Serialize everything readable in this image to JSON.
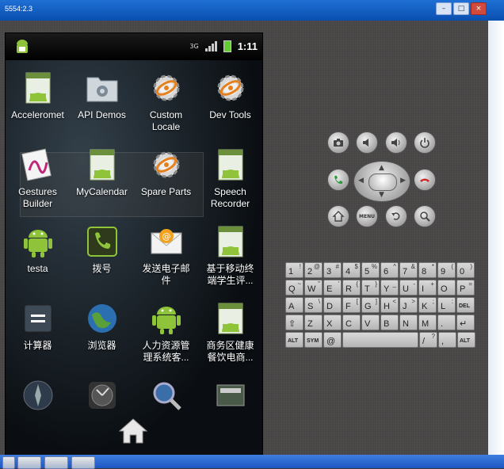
{
  "window": {
    "title": "5554:2.3",
    "minimize_label": "–",
    "maximize_label": "□",
    "close_label": "×"
  },
  "statusbar": {
    "network": "3G",
    "time": "1:11"
  },
  "apps": [
    {
      "label": "Acceleromet",
      "icon": "android-app-icon"
    },
    {
      "label": "API Demos",
      "icon": "folder-gear-icon"
    },
    {
      "label": "Custom\nLocale",
      "icon": "gear-icon"
    },
    {
      "label": "Dev Tools",
      "icon": "gear-icon"
    },
    {
      "label": "Gestures\nBuilder",
      "icon": "gesture-icon"
    },
    {
      "label": "MyCalendar",
      "icon": "android-app-icon"
    },
    {
      "label": "Spare Parts",
      "icon": "gear-icon"
    },
    {
      "label": "Speech\nRecorder",
      "icon": "android-app-icon"
    },
    {
      "label": "testa",
      "icon": "android-robot-icon"
    },
    {
      "label": "拨号",
      "icon": "phone-icon"
    },
    {
      "label": "发送电子邮\n件",
      "icon": "email-icon"
    },
    {
      "label": "基于移动终\n端学生评...",
      "icon": "android-app-icon"
    },
    {
      "label": "计算器",
      "icon": "calculator-icon"
    },
    {
      "label": "浏览器",
      "icon": "globe-icon"
    },
    {
      "label": "人力资源管\n理系统客...",
      "icon": "android-robot-icon"
    },
    {
      "label": "商务区健康\n餐饮电商...",
      "icon": "android-app-icon"
    },
    {
      "label": "",
      "icon": "compass-icon"
    },
    {
      "label": "",
      "icon": "clock-icon"
    },
    {
      "label": "",
      "icon": "search-icon"
    },
    {
      "label": "",
      "icon": "gallery-icon"
    }
  ],
  "controls": {
    "camera": "camera",
    "volume_down": "volume-down",
    "volume_up": "volume-up",
    "power": "power",
    "call": "call",
    "end_call": "end-call",
    "home": "home",
    "menu": "MENU",
    "back": "back",
    "search": "search"
  },
  "keyboard": {
    "rows": [
      [
        {
          "m": "1",
          "s": "!"
        },
        {
          "m": "2",
          "s": "@"
        },
        {
          "m": "3",
          "s": "#"
        },
        {
          "m": "4",
          "s": "$"
        },
        {
          "m": "5",
          "s": "%"
        },
        {
          "m": "6",
          "s": "^"
        },
        {
          "m": "7",
          "s": "&"
        },
        {
          "m": "8",
          "s": "*"
        },
        {
          "m": "9",
          "s": "("
        },
        {
          "m": "0",
          "s": ")"
        }
      ],
      [
        {
          "m": "Q",
          "s": "~"
        },
        {
          "m": "W",
          "s": "\""
        },
        {
          "m": "E",
          "s": "'"
        },
        {
          "m": "R",
          "s": "{"
        },
        {
          "m": "T",
          "s": "}"
        },
        {
          "m": "Y",
          "s": "_"
        },
        {
          "m": "U",
          "s": "-"
        },
        {
          "m": "I",
          "s": "+"
        },
        {
          "m": "O",
          "s": ""
        },
        {
          "m": "P",
          "s": "="
        }
      ],
      [
        {
          "m": "A",
          "s": ""
        },
        {
          "m": "S",
          "s": "\\"
        },
        {
          "m": "D",
          "s": ""
        },
        {
          "m": "F",
          "s": "["
        },
        {
          "m": "G",
          "s": "]"
        },
        {
          "m": "H",
          "s": "<"
        },
        {
          "m": "J",
          "s": ">"
        },
        {
          "m": "K",
          "s": ";"
        },
        {
          "m": "L",
          "s": ":"
        },
        {
          "m": "DEL",
          "s": ""
        }
      ],
      [
        {
          "m": "⇧",
          "s": ""
        },
        {
          "m": "Z",
          "s": ""
        },
        {
          "m": "X",
          "s": ""
        },
        {
          "m": "C",
          "s": ""
        },
        {
          "m": "V",
          "s": ""
        },
        {
          "m": "B",
          "s": ""
        },
        {
          "m": "N",
          "s": ""
        },
        {
          "m": "M",
          "s": ""
        },
        {
          "m": ".",
          "s": ""
        },
        {
          "m": "↵",
          "s": ""
        }
      ],
      [
        {
          "m": "ALT",
          "s": ""
        },
        {
          "m": "SYM",
          "s": ""
        },
        {
          "m": "@",
          "s": ""
        },
        {
          "m": "",
          "s": ""
        },
        {
          "m": "/",
          "s": "?"
        },
        {
          "m": ",",
          "s": ""
        },
        {
          "m": "ALT",
          "s": ""
        }
      ]
    ]
  },
  "colors": {
    "call_green": "#2a9a3a",
    "end_red": "#cc2a2a",
    "android_green": "#8fc43a"
  }
}
